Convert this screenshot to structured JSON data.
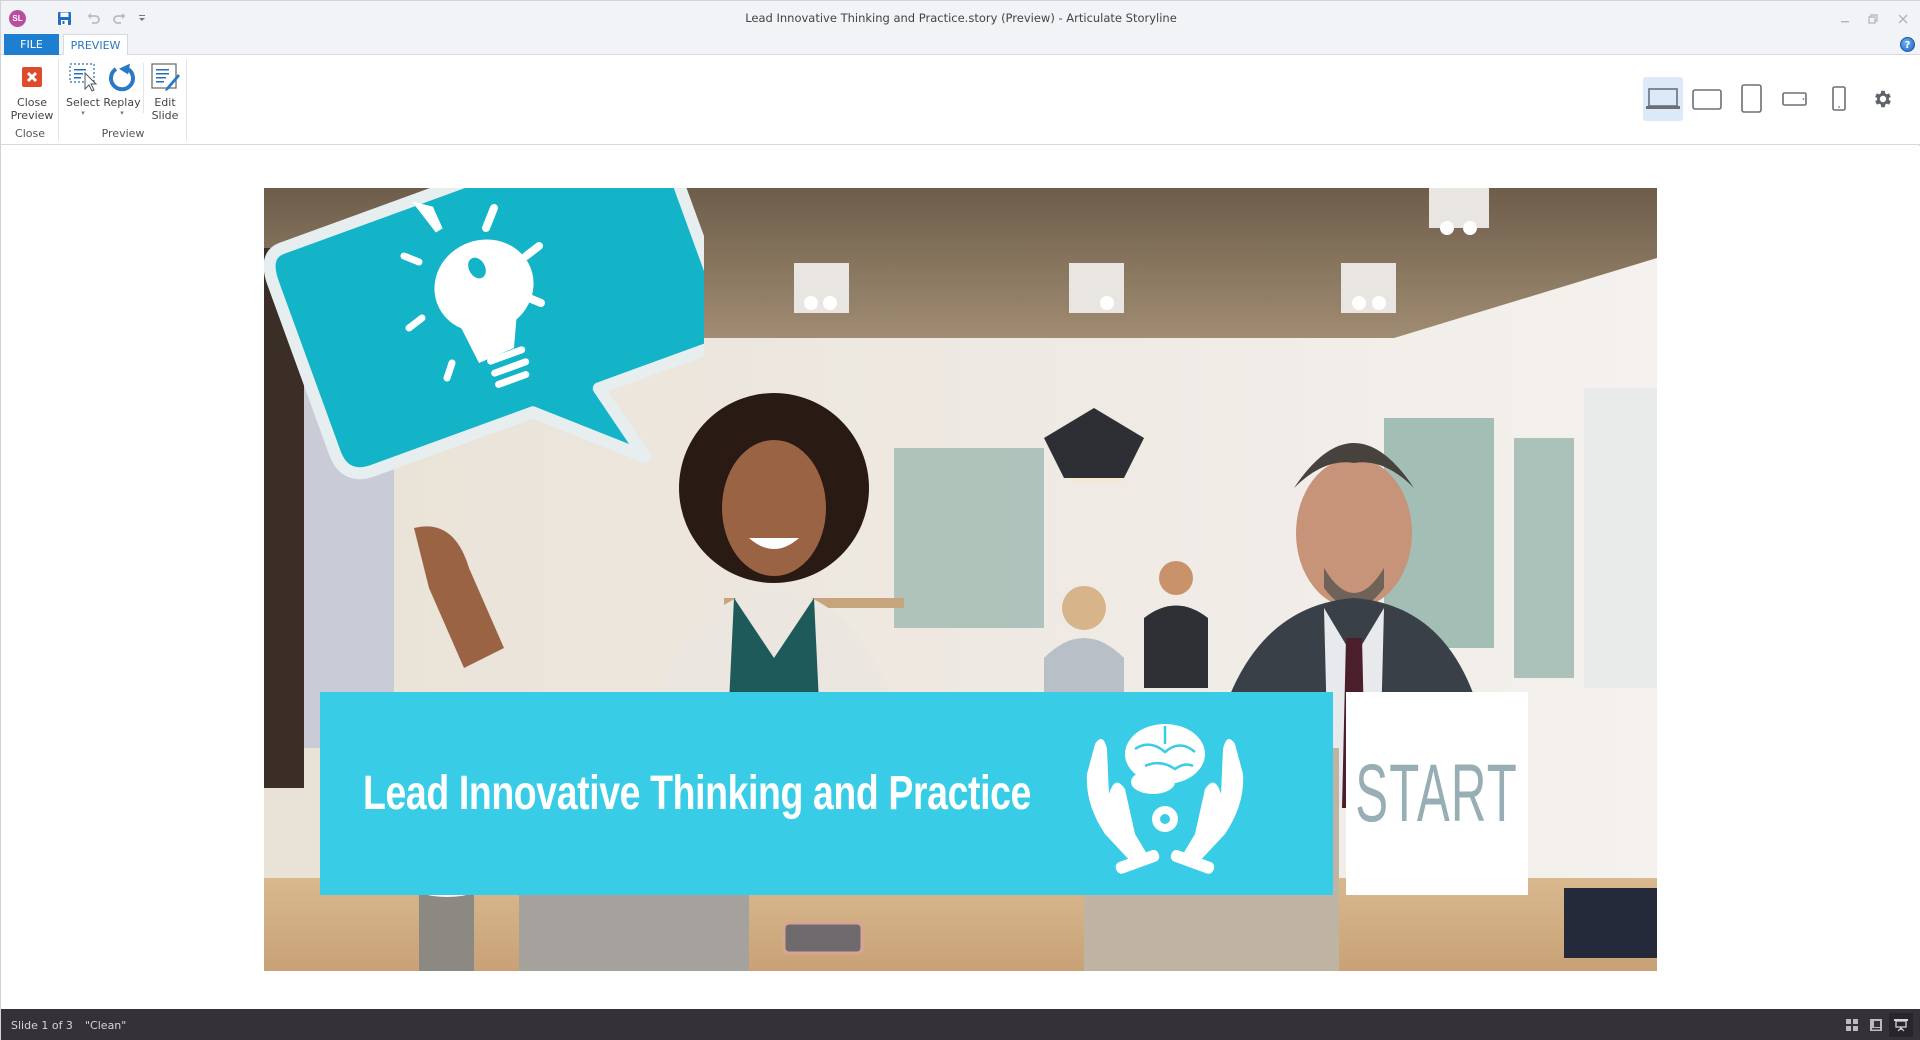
{
  "window": {
    "title": "Lead Innovative Thinking and Practice.story (Preview) -  Articulate Storyline",
    "app_logo_text": "SL",
    "quick_access": [
      {
        "icon": "save-icon",
        "label": "Save"
      },
      {
        "icon": "undo-icon",
        "label": "Undo"
      },
      {
        "icon": "redo-icon",
        "label": "Redo"
      },
      {
        "icon": "customize-qat-icon",
        "label": "Customize Quick Access Toolbar"
      }
    ],
    "controls": [
      "minimize",
      "restore",
      "close"
    ]
  },
  "tabs": [
    {
      "label": "FILE",
      "active": false
    },
    {
      "label": "PREVIEW",
      "active": true
    }
  ],
  "help_label": "?",
  "ribbon": {
    "groups": [
      {
        "label": "Close",
        "buttons": [
          {
            "label_line1": "Close",
            "label_line2": "Preview",
            "icon": "close-preview-icon"
          }
        ]
      },
      {
        "label": "Preview",
        "buttons": [
          {
            "label_line1": "Select",
            "caret": "▾",
            "icon": "select-icon"
          },
          {
            "label_line1": "Replay",
            "caret": "▾",
            "icon": "replay-icon"
          },
          {
            "label_line1": "Edit",
            "label_line2": "Slide",
            "icon": "edit-slide-icon"
          }
        ]
      }
    ],
    "devices": [
      {
        "name": "desktop",
        "active": true
      },
      {
        "name": "tablet-landscape",
        "active": false
      },
      {
        "name": "tablet-portrait",
        "active": false
      },
      {
        "name": "phone-landscape",
        "active": false
      },
      {
        "name": "phone-portrait",
        "active": false
      }
    ],
    "settings_icon": "gear-icon"
  },
  "slide": {
    "title": "Lead Innovative Thinking and Practice",
    "start_label": "START",
    "banner_color": "#38cce6",
    "bubble_color": "#13b3c8",
    "start_text_color": "#97aeb5"
  },
  "status": {
    "slide_position": "Slide 1 of 3",
    "theme": "\"Clean\"",
    "views": [
      "normal-view",
      "slide-sorter-view",
      "preview-view"
    ]
  }
}
